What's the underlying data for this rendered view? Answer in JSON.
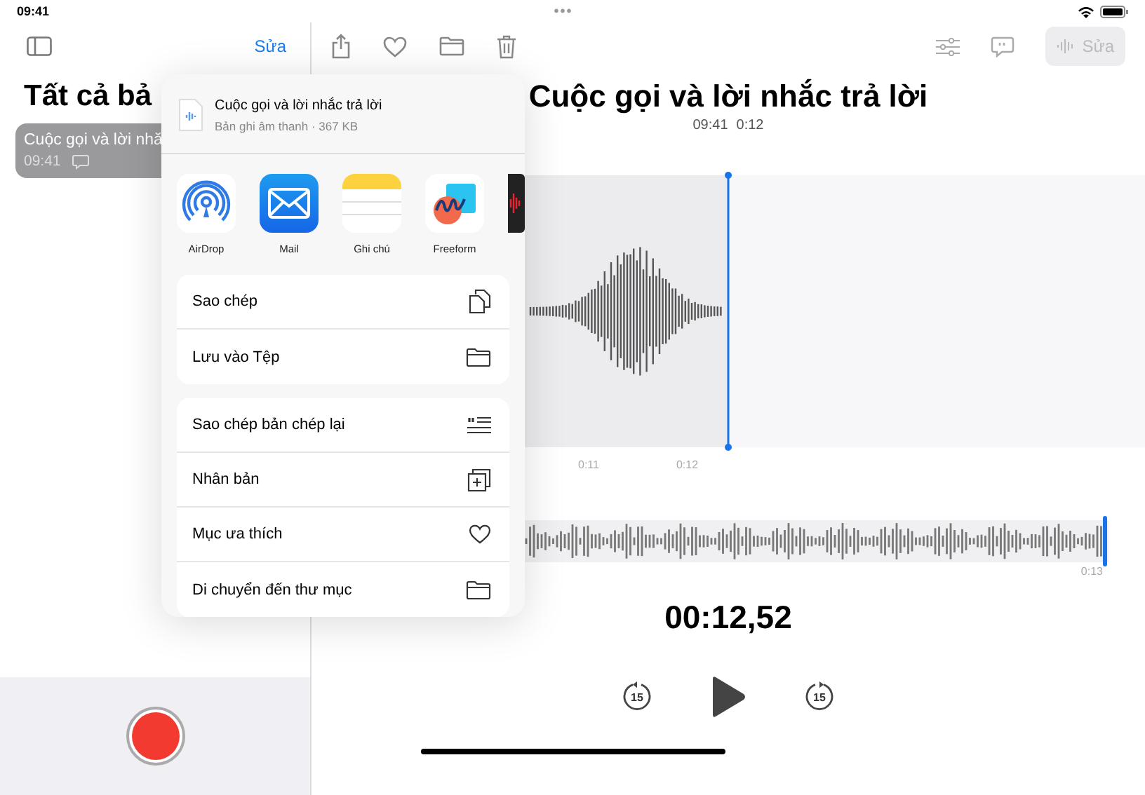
{
  "status_bar": {
    "time": "09:41",
    "more": "•••"
  },
  "sidebar": {
    "edit": "Sửa",
    "title": "Tất cả bả",
    "items": [
      {
        "title": "Cuộc gọi và lời nhă",
        "time": "09:41",
        "has_transcript": true,
        "selected": true
      }
    ]
  },
  "detail": {
    "edit": "Sửa",
    "title": "Cuộc gọi và lời nhắc trả lời",
    "time": "09:41",
    "duration": "0:12",
    "ticks": [
      "0:11",
      "0:12"
    ],
    "end_label": "0:13",
    "scrubber": {
      "level": 0.99
    },
    "elapsed": "00:12,52",
    "skip_back": "15",
    "skip_forward": "15"
  },
  "share_sheet": {
    "title": "Cuộc gọi và lời nhắc trả lời",
    "subtitle": "Bản ghi âm thanh · 367 KB",
    "apps": [
      {
        "kind": "airdrop",
        "name": "AirDrop"
      },
      {
        "kind": "mail",
        "name": "Mail"
      },
      {
        "kind": "notes",
        "name": "Ghi chú"
      },
      {
        "kind": "freeform",
        "name": "Freeform"
      },
      {
        "kind": "voice"
      }
    ],
    "action_groups": [
      [
        {
          "kind": "copy",
          "label": "Sao chép"
        },
        {
          "kind": "folder",
          "label": "Lưu vào Tệp"
        }
      ],
      [
        {
          "kind": "quote",
          "label": "Sao chép bản chép lại"
        },
        {
          "kind": "duplicate",
          "label": "Nhân bản"
        },
        {
          "kind": "heart",
          "label": "Mục ưa thích"
        },
        {
          "kind": "folder",
          "label": "Di chuyển đến thư mục"
        }
      ]
    ]
  }
}
